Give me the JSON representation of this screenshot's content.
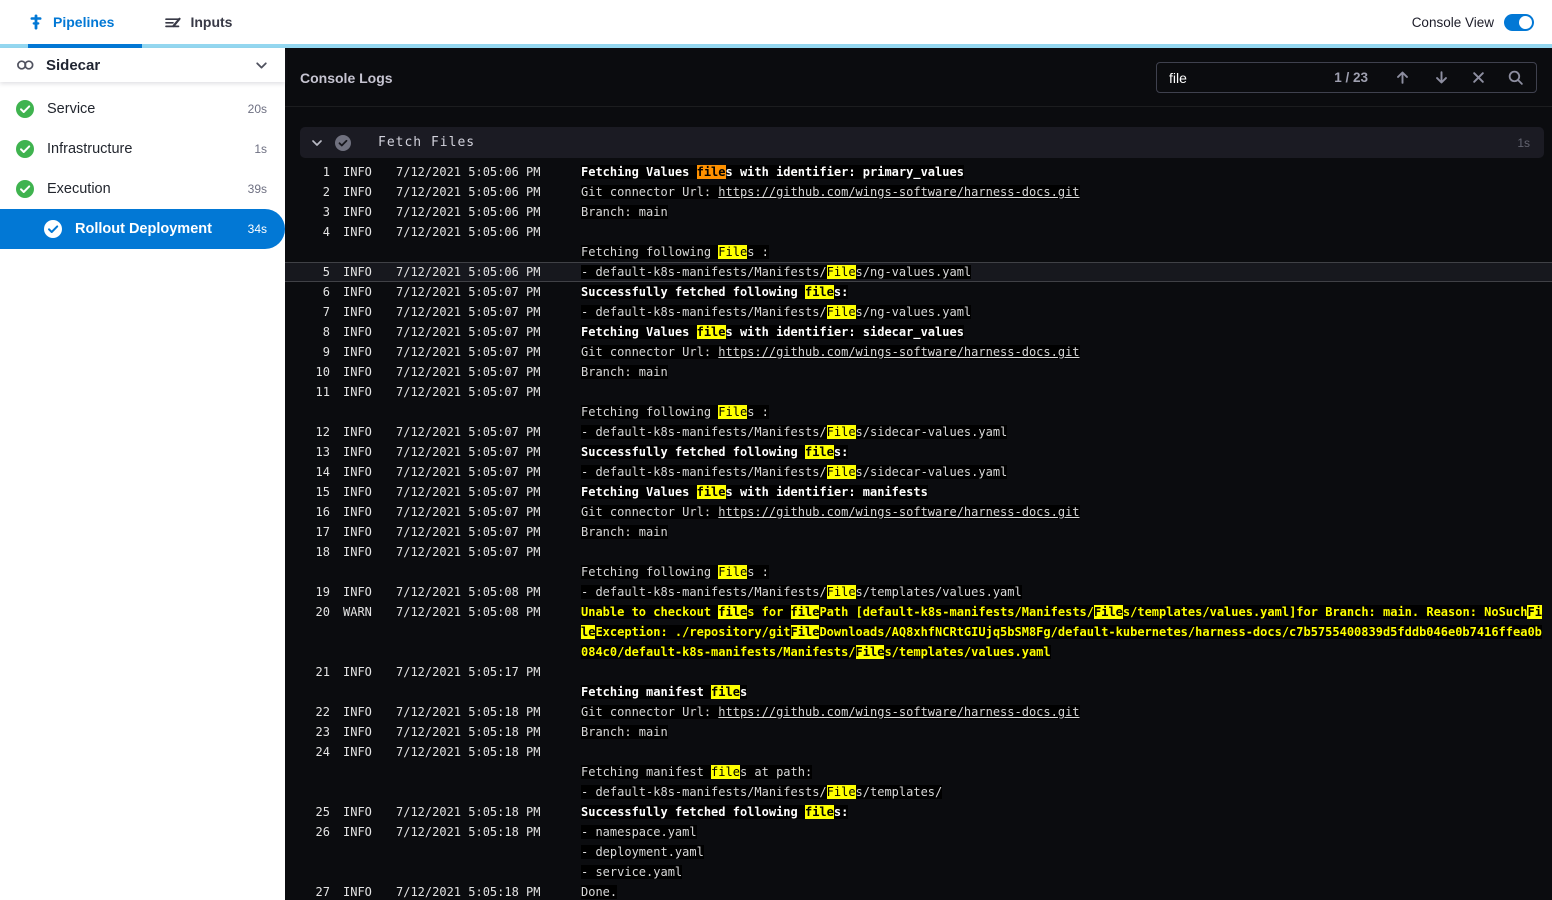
{
  "colors": {
    "accent": "#0278d5",
    "success_green": "#3fb34f",
    "match_current_bg": "#ff9100",
    "match_bg": "#ffff00",
    "warn_text": "#ffff00",
    "tab_track": "#94d7f0"
  },
  "header": {
    "tabs": [
      {
        "label": "Pipelines"
      },
      {
        "label": "Inputs"
      }
    ],
    "console_view": {
      "label": "Console View",
      "enabled": true
    }
  },
  "sidebar": {
    "title": "Sidecar",
    "items": [
      {
        "label": "Service",
        "duration": "20s",
        "status": "success",
        "selected": false
      },
      {
        "label": "Infrastructure",
        "duration": "1s",
        "status": "success",
        "selected": false
      },
      {
        "label": "Execution",
        "duration": "39s",
        "status": "success",
        "selected": false
      },
      {
        "label": "Rollout Deployment",
        "duration": "34s",
        "status": "success",
        "selected": true
      }
    ]
  },
  "console": {
    "title": "Console Logs",
    "search": {
      "query": "file",
      "counter": "1 / 23"
    },
    "section": {
      "title": "Fetch Files",
      "duration": "1s"
    },
    "entries": [
      {
        "n": 1,
        "lvl": "INFO",
        "ts": "7/12/2021 5:05:06 PM",
        "lines": [
          {
            "b": true,
            "segs": [
              {
                "t": "Fetching Values "
              },
              {
                "t": "file",
                "s": "c"
              },
              {
                "t": "s with identifier: primary_values"
              }
            ]
          }
        ]
      },
      {
        "n": 2,
        "lvl": "INFO",
        "ts": "7/12/2021 5:05:06 PM",
        "lines": [
          {
            "segs": [
              {
                "t": "Git connector Url: "
              },
              {
                "t": "https://github.com/wings-software/harness-docs.git",
                "s": "l"
              }
            ]
          }
        ]
      },
      {
        "n": 3,
        "lvl": "INFO",
        "ts": "7/12/2021 5:05:06 PM",
        "lines": [
          {
            "segs": [
              {
                "t": "Branch: main"
              }
            ]
          }
        ]
      },
      {
        "n": 4,
        "lvl": "INFO",
        "ts": "7/12/2021 5:05:06 PM",
        "lines": [
          {
            "segs": [
              {
                "t": ""
              }
            ]
          },
          {
            "segs": [
              {
                "t": "Fetching following "
              },
              {
                "t": "File",
                "s": "h"
              },
              {
                "t": "s :"
              }
            ]
          }
        ]
      },
      {
        "n": 5,
        "lvl": "INFO",
        "ts": "7/12/2021 5:05:06 PM",
        "sel": true,
        "lines": [
          {
            "segs": [
              {
                "t": "- default-k8s-manifests/Manifests/"
              },
              {
                "t": "File",
                "s": "h"
              },
              {
                "t": "s/ng-values.yaml"
              }
            ]
          }
        ]
      },
      {
        "n": 6,
        "lvl": "INFO",
        "ts": "7/12/2021 5:05:07 PM",
        "lines": [
          {
            "b": true,
            "segs": [
              {
                "t": "Successfully fetched following "
              },
              {
                "t": "file",
                "s": "h"
              },
              {
                "t": "s:"
              }
            ]
          }
        ]
      },
      {
        "n": 7,
        "lvl": "INFO",
        "ts": "7/12/2021 5:05:07 PM",
        "lines": [
          {
            "segs": [
              {
                "t": "- default-k8s-manifests/Manifests/"
              },
              {
                "t": "File",
                "s": "h"
              },
              {
                "t": "s/ng-values.yaml"
              }
            ]
          }
        ]
      },
      {
        "n": 8,
        "lvl": "INFO",
        "ts": "7/12/2021 5:05:07 PM",
        "lines": [
          {
            "b": true,
            "segs": [
              {
                "t": "Fetching Values "
              },
              {
                "t": "file",
                "s": "h"
              },
              {
                "t": "s with identifier: sidecar_values"
              }
            ]
          }
        ]
      },
      {
        "n": 9,
        "lvl": "INFO",
        "ts": "7/12/2021 5:05:07 PM",
        "lines": [
          {
            "segs": [
              {
                "t": "Git connector Url: "
              },
              {
                "t": "https://github.com/wings-software/harness-docs.git",
                "s": "l"
              }
            ]
          }
        ]
      },
      {
        "n": 10,
        "lvl": "INFO",
        "ts": "7/12/2021 5:05:07 PM",
        "lines": [
          {
            "segs": [
              {
                "t": "Branch: main"
              }
            ]
          }
        ]
      },
      {
        "n": 11,
        "lvl": "INFO",
        "ts": "7/12/2021 5:05:07 PM",
        "lines": [
          {
            "segs": [
              {
                "t": ""
              }
            ]
          },
          {
            "segs": [
              {
                "t": "Fetching following "
              },
              {
                "t": "File",
                "s": "h"
              },
              {
                "t": "s :"
              }
            ]
          }
        ]
      },
      {
        "n": 12,
        "lvl": "INFO",
        "ts": "7/12/2021 5:05:07 PM",
        "lines": [
          {
            "segs": [
              {
                "t": "- default-k8s-manifests/Manifests/"
              },
              {
                "t": "File",
                "s": "h"
              },
              {
                "t": "s/sidecar-values.yaml"
              }
            ]
          }
        ]
      },
      {
        "n": 13,
        "lvl": "INFO",
        "ts": "7/12/2021 5:05:07 PM",
        "lines": [
          {
            "b": true,
            "segs": [
              {
                "t": "Successfully fetched following "
              },
              {
                "t": "file",
                "s": "h"
              },
              {
                "t": "s:"
              }
            ]
          }
        ]
      },
      {
        "n": 14,
        "lvl": "INFO",
        "ts": "7/12/2021 5:05:07 PM",
        "lines": [
          {
            "segs": [
              {
                "t": "- default-k8s-manifests/Manifests/"
              },
              {
                "t": "File",
                "s": "h"
              },
              {
                "t": "s/sidecar-values.yaml"
              }
            ]
          }
        ]
      },
      {
        "n": 15,
        "lvl": "INFO",
        "ts": "7/12/2021 5:05:07 PM",
        "lines": [
          {
            "b": true,
            "segs": [
              {
                "t": "Fetching Values "
              },
              {
                "t": "file",
                "s": "h"
              },
              {
                "t": "s with identifier: manifests"
              }
            ]
          }
        ]
      },
      {
        "n": 16,
        "lvl": "INFO",
        "ts": "7/12/2021 5:05:07 PM",
        "lines": [
          {
            "segs": [
              {
                "t": "Git connector Url: "
              },
              {
                "t": "https://github.com/wings-software/harness-docs.git",
                "s": "l"
              }
            ]
          }
        ]
      },
      {
        "n": 17,
        "lvl": "INFO",
        "ts": "7/12/2021 5:05:07 PM",
        "lines": [
          {
            "segs": [
              {
                "t": "Branch: main"
              }
            ]
          }
        ]
      },
      {
        "n": 18,
        "lvl": "INFO",
        "ts": "7/12/2021 5:05:07 PM",
        "lines": [
          {
            "segs": [
              {
                "t": ""
              }
            ]
          },
          {
            "segs": [
              {
                "t": "Fetching following "
              },
              {
                "t": "File",
                "s": "h"
              },
              {
                "t": "s :"
              }
            ]
          }
        ]
      },
      {
        "n": 19,
        "lvl": "INFO",
        "ts": "7/12/2021 5:05:08 PM",
        "lines": [
          {
            "segs": [
              {
                "t": "- default-k8s-manifests/Manifests/"
              },
              {
                "t": "File",
                "s": "h"
              },
              {
                "t": "s/templates/values.yaml"
              }
            ]
          }
        ]
      },
      {
        "n": 20,
        "lvl": "WARN",
        "ts": "7/12/2021 5:05:08 PM",
        "lines": [
          {
            "b": true,
            "segs": [
              {
                "t": "Unable to checkout "
              },
              {
                "t": "file",
                "s": "h"
              },
              {
                "t": "s for "
              },
              {
                "t": "file",
                "s": "h"
              },
              {
                "t": "Path [default-k8s-manifests/Manifests/"
              },
              {
                "t": "File",
                "s": "h"
              },
              {
                "t": "s/templates/values.yaml]for Branch: main. Reason: NoSuch"
              },
              {
                "t": "File",
                "s": "h"
              },
              {
                "t": "Exception: ./repository/git"
              },
              {
                "t": "File",
                "s": "h"
              },
              {
                "t": "Downloads/AQ8xhfNCRtGIUjq5bSM8Fg/default-kubernetes/harness-docs/c7b5755400839d5fddb046e0b7416ffea0b084c0/default-k8s-manifests/Manifests/"
              },
              {
                "t": "File",
                "s": "h"
              },
              {
                "t": "s/templates/values.yaml"
              }
            ]
          }
        ]
      },
      {
        "n": 21,
        "lvl": "INFO",
        "ts": "7/12/2021 5:05:17 PM",
        "lines": [
          {
            "segs": [
              {
                "t": ""
              }
            ]
          },
          {
            "b": true,
            "segs": [
              {
                "t": "Fetching manifest "
              },
              {
                "t": "file",
                "s": "h"
              },
              {
                "t": "s"
              }
            ]
          }
        ]
      },
      {
        "n": 22,
        "lvl": "INFO",
        "ts": "7/12/2021 5:05:18 PM",
        "lines": [
          {
            "segs": [
              {
                "t": "Git connector Url: "
              },
              {
                "t": "https://github.com/wings-software/harness-docs.git",
                "s": "l"
              }
            ]
          }
        ]
      },
      {
        "n": 23,
        "lvl": "INFO",
        "ts": "7/12/2021 5:05:18 PM",
        "lines": [
          {
            "segs": [
              {
                "t": "Branch: main"
              }
            ]
          }
        ]
      },
      {
        "n": 24,
        "lvl": "INFO",
        "ts": "7/12/2021 5:05:18 PM",
        "lines": [
          {
            "segs": [
              {
                "t": ""
              }
            ]
          },
          {
            "segs": [
              {
                "t": "Fetching manifest "
              },
              {
                "t": "file",
                "s": "h"
              },
              {
                "t": "s at path:"
              }
            ]
          },
          {
            "segs": [
              {
                "t": "- default-k8s-manifests/Manifests/"
              },
              {
                "t": "File",
                "s": "h"
              },
              {
                "t": "s/templates/"
              }
            ]
          }
        ]
      },
      {
        "n": 25,
        "lvl": "INFO",
        "ts": "7/12/2021 5:05:18 PM",
        "lines": [
          {
            "b": true,
            "segs": [
              {
                "t": "Successfully fetched following "
              },
              {
                "t": "file",
                "s": "h"
              },
              {
                "t": "s:"
              }
            ]
          }
        ]
      },
      {
        "n": 26,
        "lvl": "INFO",
        "ts": "7/12/2021 5:05:18 PM",
        "lines": [
          {
            "segs": [
              {
                "t": "- namespace.yaml"
              }
            ]
          },
          {
            "segs": [
              {
                "t": "- deployment.yaml"
              }
            ]
          },
          {
            "segs": [
              {
                "t": "- service.yaml"
              }
            ]
          }
        ]
      },
      {
        "n": 27,
        "lvl": "INFO",
        "ts": "7/12/2021 5:05:18 PM",
        "lines": [
          {
            "segs": [
              {
                "t": "Done."
              }
            ]
          }
        ]
      }
    ]
  }
}
